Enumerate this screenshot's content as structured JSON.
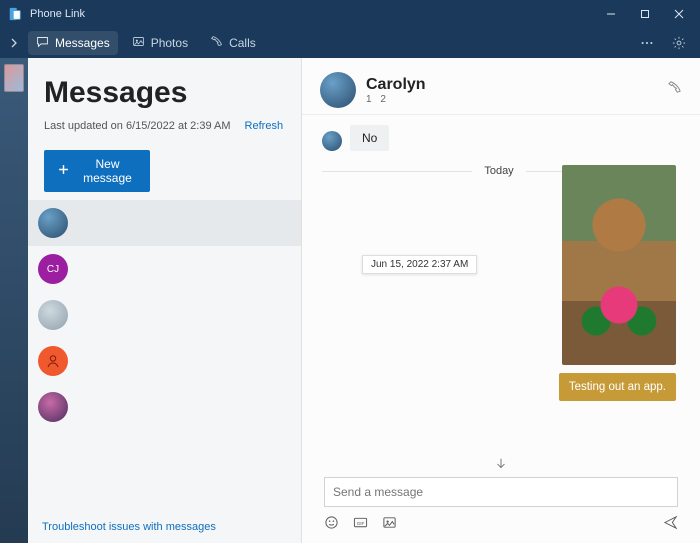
{
  "app": {
    "title": "Phone Link"
  },
  "tabs": {
    "messages": "Messages",
    "photos": "Photos",
    "calls": "Calls"
  },
  "sidebar": {
    "title": "Messages",
    "last_updated": "Last updated on 6/15/2022 at 2:39 AM",
    "refresh": "Refresh",
    "new_message": "New message",
    "troubleshoot": "Troubleshoot issues with messages",
    "conversations": [
      {
        "initials": "",
        "color": "radial-gradient(circle at 35% 30%, #6aa0c8, #2a4d6d)"
      },
      {
        "initials": "CJ",
        "color": "#9b1fa0"
      },
      {
        "initials": "",
        "color": "radial-gradient(circle at 40% 35%, #cfd9df, #90a0ac)"
      },
      {
        "initials": "",
        "color": "#f0582e",
        "silhouette": true
      },
      {
        "initials": "",
        "color": "radial-gradient(circle at 40% 35%, #c86aa8, #4a2d5d)"
      }
    ]
  },
  "chat": {
    "name": "Carolyn",
    "phone_masked": "1                                2",
    "incoming": [
      {
        "text": "No"
      }
    ],
    "date_separator": "Today",
    "tooltip": "Jun 15, 2022 2:37 AM",
    "outgoing_text": "Testing out an app.",
    "composer_placeholder": "Send a message"
  },
  "icons": {
    "back": "back-icon",
    "messages": "chat-icon",
    "photos": "photo-icon",
    "calls": "phone-icon",
    "more": "more-icon",
    "settings": "gear-icon",
    "minimize": "minimize-icon",
    "maximize": "maximize-icon",
    "close": "close-icon",
    "plus": "plus-icon",
    "call": "phone-outline-icon",
    "scrolldown": "chevron-down-icon",
    "emoji": "emoji-icon",
    "gif": "gif-icon",
    "image": "image-icon",
    "send": "send-icon"
  }
}
